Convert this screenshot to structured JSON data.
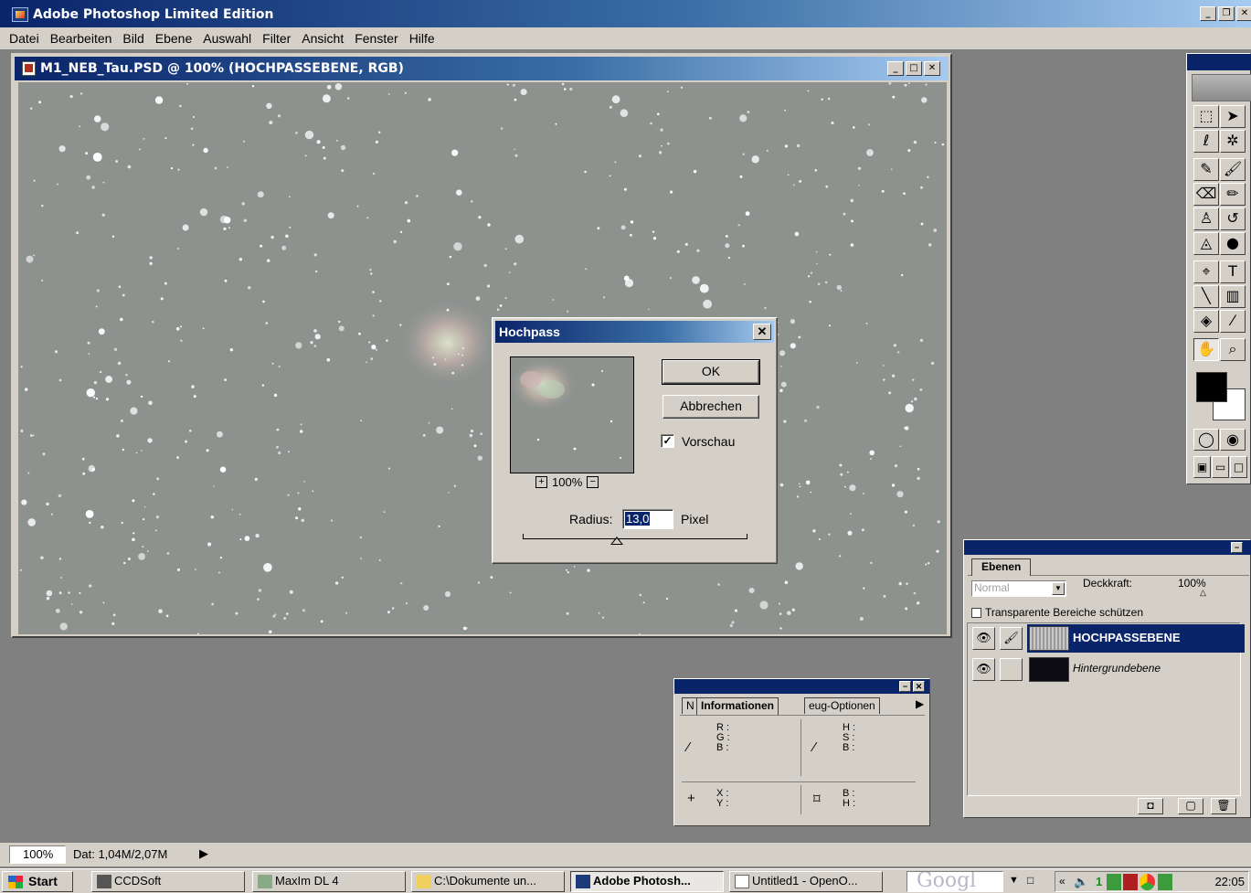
{
  "app": {
    "title": "Adobe Photoshop Limited Edition"
  },
  "menu": [
    "Datei",
    "Bearbeiten",
    "Bild",
    "Ebene",
    "Auswahl",
    "Filter",
    "Ansicht",
    "Fenster",
    "Hilfe"
  ],
  "document": {
    "title": "M1_NEB_Tau.PSD @ 100% (HOCHPASSEBENE, RGB)"
  },
  "dialog": {
    "title": "Hochpass",
    "ok_label": "OK",
    "cancel_label": "Abbrechen",
    "preview_label": "Vorschau",
    "preview_checked": true,
    "zoom": "100%",
    "radius_label": "Radius:",
    "radius_value": "13,0",
    "radius_unit": "Pixel"
  },
  "info_panel": {
    "tabs": [
      "N",
      "Informationen",
      "eug-Optionen"
    ],
    "rgb_labels": "R :\nG :\nB :",
    "hsb_labels": "H :\nS :\nB :",
    "xy_labels": "X :\nY :",
    "bh_labels": "B :\nH :"
  },
  "layers_panel": {
    "tab": "Ebenen",
    "blend_mode": "Normal",
    "opacity_label": "Deckkraft:",
    "opacity_value": "100%",
    "lock_label": "Transparente Bereiche schützen",
    "layers": [
      {
        "name": "HOCHPASSEBENE",
        "selected": true
      },
      {
        "name": "Hintergrundebene",
        "selected": false
      }
    ]
  },
  "statusbar": {
    "zoom": "100%",
    "doc_size": "Dat: 1,04M/2,07M"
  },
  "taskbar": {
    "start_label": "Start",
    "tasks": [
      "CCDSoft",
      "MaxIm DL 4",
      "C:\\Dokumente un...",
      "Adobe Photosh...",
      "Untitled1 - OpenO..."
    ],
    "search_text": "Googl",
    "clock": "22:05"
  }
}
